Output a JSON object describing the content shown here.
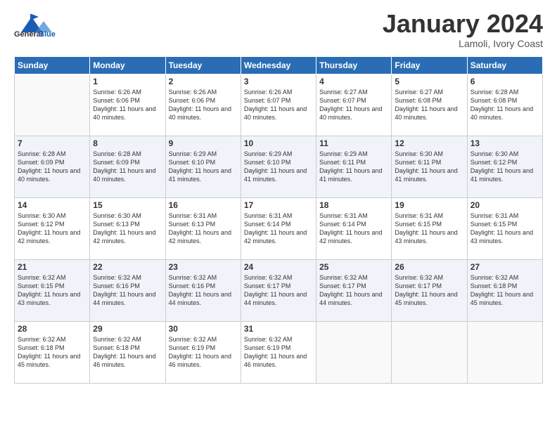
{
  "header": {
    "logo_general": "General",
    "logo_blue": "Blue",
    "month_title": "January 2024",
    "location": "Lamoli, Ivory Coast"
  },
  "days_of_week": [
    "Sunday",
    "Monday",
    "Tuesday",
    "Wednesday",
    "Thursday",
    "Friday",
    "Saturday"
  ],
  "weeks": [
    [
      {
        "day": "",
        "sunrise": "",
        "sunset": "",
        "daylight": ""
      },
      {
        "day": "1",
        "sunrise": "Sunrise: 6:26 AM",
        "sunset": "Sunset: 6:06 PM",
        "daylight": "Daylight: 11 hours and 40 minutes."
      },
      {
        "day": "2",
        "sunrise": "Sunrise: 6:26 AM",
        "sunset": "Sunset: 6:06 PM",
        "daylight": "Daylight: 11 hours and 40 minutes."
      },
      {
        "day": "3",
        "sunrise": "Sunrise: 6:26 AM",
        "sunset": "Sunset: 6:07 PM",
        "daylight": "Daylight: 11 hours and 40 minutes."
      },
      {
        "day": "4",
        "sunrise": "Sunrise: 6:27 AM",
        "sunset": "Sunset: 6:07 PM",
        "daylight": "Daylight: 11 hours and 40 minutes."
      },
      {
        "day": "5",
        "sunrise": "Sunrise: 6:27 AM",
        "sunset": "Sunset: 6:08 PM",
        "daylight": "Daylight: 11 hours and 40 minutes."
      },
      {
        "day": "6",
        "sunrise": "Sunrise: 6:28 AM",
        "sunset": "Sunset: 6:08 PM",
        "daylight": "Daylight: 11 hours and 40 minutes."
      }
    ],
    [
      {
        "day": "7",
        "sunrise": "Sunrise: 6:28 AM",
        "sunset": "Sunset: 6:09 PM",
        "daylight": "Daylight: 11 hours and 40 minutes."
      },
      {
        "day": "8",
        "sunrise": "Sunrise: 6:28 AM",
        "sunset": "Sunset: 6:09 PM",
        "daylight": "Daylight: 11 hours and 40 minutes."
      },
      {
        "day": "9",
        "sunrise": "Sunrise: 6:29 AM",
        "sunset": "Sunset: 6:10 PM",
        "daylight": "Daylight: 11 hours and 41 minutes."
      },
      {
        "day": "10",
        "sunrise": "Sunrise: 6:29 AM",
        "sunset": "Sunset: 6:10 PM",
        "daylight": "Daylight: 11 hours and 41 minutes."
      },
      {
        "day": "11",
        "sunrise": "Sunrise: 6:29 AM",
        "sunset": "Sunset: 6:11 PM",
        "daylight": "Daylight: 11 hours and 41 minutes."
      },
      {
        "day": "12",
        "sunrise": "Sunrise: 6:30 AM",
        "sunset": "Sunset: 6:11 PM",
        "daylight": "Daylight: 11 hours and 41 minutes."
      },
      {
        "day": "13",
        "sunrise": "Sunrise: 6:30 AM",
        "sunset": "Sunset: 6:12 PM",
        "daylight": "Daylight: 11 hours and 41 minutes."
      }
    ],
    [
      {
        "day": "14",
        "sunrise": "Sunrise: 6:30 AM",
        "sunset": "Sunset: 6:12 PM",
        "daylight": "Daylight: 11 hours and 42 minutes."
      },
      {
        "day": "15",
        "sunrise": "Sunrise: 6:30 AM",
        "sunset": "Sunset: 6:13 PM",
        "daylight": "Daylight: 11 hours and 42 minutes."
      },
      {
        "day": "16",
        "sunrise": "Sunrise: 6:31 AM",
        "sunset": "Sunset: 6:13 PM",
        "daylight": "Daylight: 11 hours and 42 minutes."
      },
      {
        "day": "17",
        "sunrise": "Sunrise: 6:31 AM",
        "sunset": "Sunset: 6:14 PM",
        "daylight": "Daylight: 11 hours and 42 minutes."
      },
      {
        "day": "18",
        "sunrise": "Sunrise: 6:31 AM",
        "sunset": "Sunset: 6:14 PM",
        "daylight": "Daylight: 11 hours and 42 minutes."
      },
      {
        "day": "19",
        "sunrise": "Sunrise: 6:31 AM",
        "sunset": "Sunset: 6:15 PM",
        "daylight": "Daylight: 11 hours and 43 minutes."
      },
      {
        "day": "20",
        "sunrise": "Sunrise: 6:31 AM",
        "sunset": "Sunset: 6:15 PM",
        "daylight": "Daylight: 11 hours and 43 minutes."
      }
    ],
    [
      {
        "day": "21",
        "sunrise": "Sunrise: 6:32 AM",
        "sunset": "Sunset: 6:15 PM",
        "daylight": "Daylight: 11 hours and 43 minutes."
      },
      {
        "day": "22",
        "sunrise": "Sunrise: 6:32 AM",
        "sunset": "Sunset: 6:16 PM",
        "daylight": "Daylight: 11 hours and 44 minutes."
      },
      {
        "day": "23",
        "sunrise": "Sunrise: 6:32 AM",
        "sunset": "Sunset: 6:16 PM",
        "daylight": "Daylight: 11 hours and 44 minutes."
      },
      {
        "day": "24",
        "sunrise": "Sunrise: 6:32 AM",
        "sunset": "Sunset: 6:17 PM",
        "daylight": "Daylight: 11 hours and 44 minutes."
      },
      {
        "day": "25",
        "sunrise": "Sunrise: 6:32 AM",
        "sunset": "Sunset: 6:17 PM",
        "daylight": "Daylight: 11 hours and 44 minutes."
      },
      {
        "day": "26",
        "sunrise": "Sunrise: 6:32 AM",
        "sunset": "Sunset: 6:17 PM",
        "daylight": "Daylight: 11 hours and 45 minutes."
      },
      {
        "day": "27",
        "sunrise": "Sunrise: 6:32 AM",
        "sunset": "Sunset: 6:18 PM",
        "daylight": "Daylight: 11 hours and 45 minutes."
      }
    ],
    [
      {
        "day": "28",
        "sunrise": "Sunrise: 6:32 AM",
        "sunset": "Sunset: 6:18 PM",
        "daylight": "Daylight: 11 hours and 45 minutes."
      },
      {
        "day": "29",
        "sunrise": "Sunrise: 6:32 AM",
        "sunset": "Sunset: 6:18 PM",
        "daylight": "Daylight: 11 hours and 46 minutes."
      },
      {
        "day": "30",
        "sunrise": "Sunrise: 6:32 AM",
        "sunset": "Sunset: 6:19 PM",
        "daylight": "Daylight: 11 hours and 46 minutes."
      },
      {
        "day": "31",
        "sunrise": "Sunrise: 6:32 AM",
        "sunset": "Sunset: 6:19 PM",
        "daylight": "Daylight: 11 hours and 46 minutes."
      },
      {
        "day": "",
        "sunrise": "",
        "sunset": "",
        "daylight": ""
      },
      {
        "day": "",
        "sunrise": "",
        "sunset": "",
        "daylight": ""
      },
      {
        "day": "",
        "sunrise": "",
        "sunset": "",
        "daylight": ""
      }
    ]
  ]
}
